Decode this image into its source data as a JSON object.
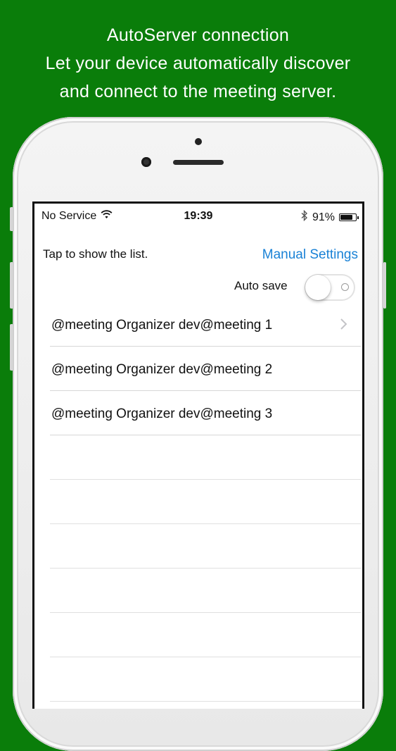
{
  "headline": {
    "line1": "AutoServer connection",
    "line2": "Let your device automatically discover",
    "line3": "and connect to the meeting server."
  },
  "status_bar": {
    "carrier": "No Service",
    "time": "19:39",
    "battery_percent": "91%",
    "battery_level": 0.91,
    "icons": [
      "wifi-icon",
      "bluetooth-icon",
      "battery-icon"
    ]
  },
  "header": {
    "hint": "Tap to show the list.",
    "manual_settings": "Manual Settings",
    "auto_save_label": "Auto save",
    "auto_save_on": false
  },
  "servers": [
    {
      "label": "@meeting Organizer dev@meeting 1",
      "has_chevron": true
    },
    {
      "label": "@meeting Organizer dev@meeting 2",
      "has_chevron": false
    },
    {
      "label": "@meeting Organizer dev@meeting 3",
      "has_chevron": false
    }
  ],
  "colors": {
    "background": "#0a7d0a",
    "link": "#1a82d6"
  }
}
